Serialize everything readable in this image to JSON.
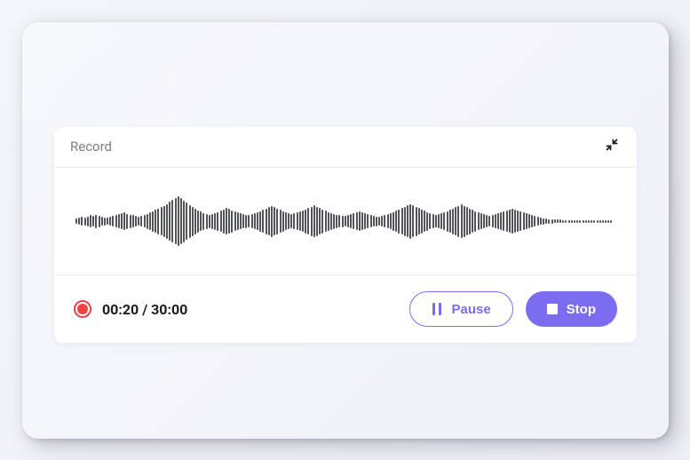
{
  "card": {
    "title": "Record",
    "minimize_icon": "minimize-icon"
  },
  "recording": {
    "elapsed": "00:20",
    "total": "30:00",
    "time_display": "00:20 / 30:00"
  },
  "buttons": {
    "pause_label": "Pause",
    "stop_label": "Stop"
  },
  "colors": {
    "accent": "#7b6cf0",
    "recording": "#ef4343",
    "waveform": "#52535b"
  },
  "waveform": {
    "sample_count": 190,
    "heights": [
      6,
      8,
      10,
      9,
      11,
      14,
      12,
      15,
      13,
      10,
      9,
      8,
      10,
      12,
      14,
      16,
      18,
      20,
      17,
      15,
      14,
      12,
      10,
      12,
      14,
      17,
      20,
      23,
      26,
      29,
      32,
      35,
      39,
      44,
      48,
      52,
      56,
      52,
      47,
      42,
      37,
      33,
      29,
      25,
      22,
      19,
      17,
      15,
      17,
      19,
      21,
      24,
      27,
      30,
      28,
      25,
      22,
      20,
      18,
      16,
      15,
      14,
      16,
      18,
      20,
      23,
      26,
      29,
      32,
      35,
      32,
      29,
      26,
      23,
      20,
      18,
      16,
      18,
      20,
      22,
      24,
      27,
      30,
      33,
      36,
      33,
      30,
      27,
      24,
      21,
      19,
      17,
      15,
      14,
      13,
      12,
      14,
      16,
      18,
      20,
      22,
      20,
      18,
      16,
      14,
      12,
      11,
      10,
      12,
      14,
      16,
      18,
      21,
      24,
      27,
      30,
      33,
      36,
      39,
      36,
      33,
      30,
      27,
      24,
      21,
      18,
      16,
      14,
      16,
      18,
      20,
      23,
      26,
      29,
      32,
      35,
      38,
      35,
      32,
      29,
      26,
      23,
      20,
      18,
      16,
      14,
      12,
      14,
      16,
      18,
      20,
      22,
      24,
      26,
      28,
      26,
      24,
      22,
      20,
      18,
      16,
      14,
      12,
      10,
      8,
      7,
      6,
      5,
      5,
      4,
      4,
      4,
      3,
      3,
      3,
      3,
      3,
      3,
      3,
      3,
      3,
      3,
      3,
      3,
      3,
      3,
      3,
      3,
      3,
      3
    ]
  }
}
